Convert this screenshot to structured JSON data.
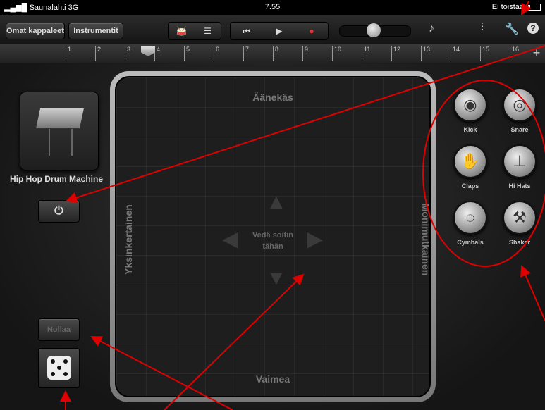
{
  "status_bar": {
    "carrier": "Saunalahti 3G",
    "time": "7.55",
    "playing_status": "Ei toistaa"
  },
  "toolbar": {
    "my_songs_label": "Omat kappaleet",
    "instruments_label": "Instrumentit",
    "icons": [
      "drum-view-icon",
      "list-view-icon",
      "rewind-icon",
      "play-icon",
      "record-icon",
      "volume-slider",
      "metronome-icon",
      "mixer-icon",
      "wrench-icon",
      "help-icon"
    ]
  },
  "ruler": {
    "bars": [
      "1",
      "2",
      "3",
      "4",
      "5",
      "6",
      "7",
      "8",
      "9",
      "10",
      "11",
      "12",
      "13",
      "14",
      "15",
      "16"
    ],
    "add_label": "+"
  },
  "instrument": {
    "name": "Hip Hop Drum Machine"
  },
  "controls": {
    "power_icon": "power-icon",
    "reset_label": "Nollaa",
    "dice_icon": "dice-icon"
  },
  "pad": {
    "top": "Äänekäs",
    "bottom": "Vaimea",
    "left": "Yksinkertainen",
    "right": "Monimutkainen",
    "center_line1": "Vedä soitin",
    "center_line2": "tähän"
  },
  "drums": [
    {
      "name": "Kick",
      "glyph": "◉"
    },
    {
      "name": "Snare",
      "glyph": "◎"
    },
    {
      "name": "Claps",
      "glyph": "✋"
    },
    {
      "name": "Hi Hats",
      "glyph": "⊥"
    },
    {
      "name": "Cymbals",
      "glyph": "◌"
    },
    {
      "name": "Shaker",
      "glyph": "⚒"
    }
  ],
  "annotation_color": "#e00000"
}
